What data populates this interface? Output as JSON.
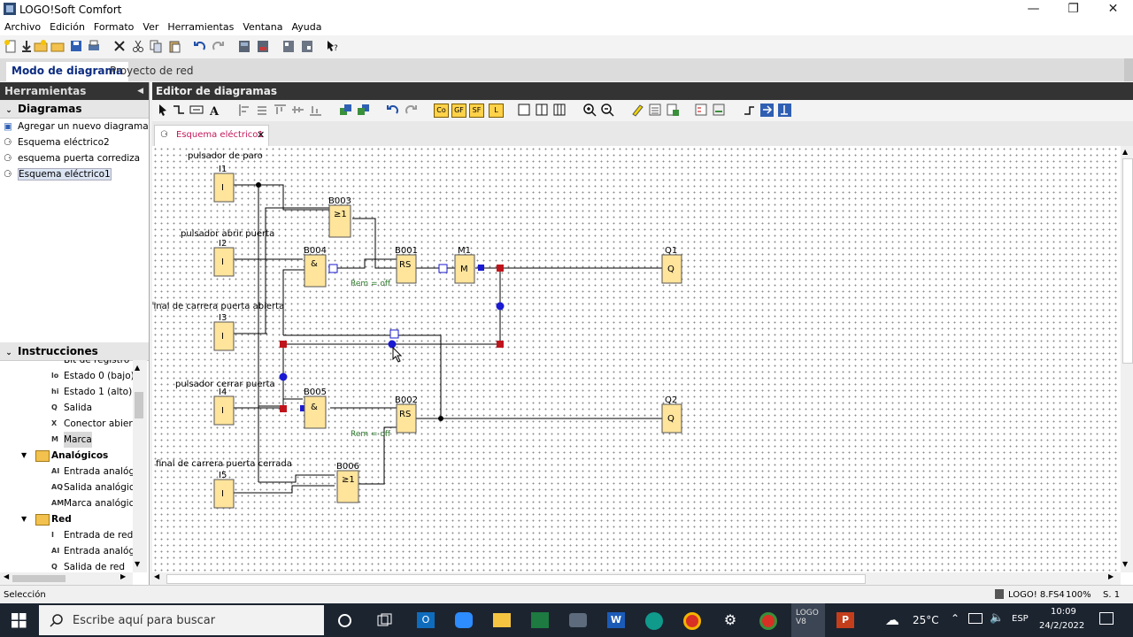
{
  "window": {
    "title": "LOGO!Soft Comfort",
    "minimize": "—",
    "restore": "❐",
    "close": "✕"
  },
  "menu": [
    "Archivo",
    "Edición",
    "Formato",
    "Ver",
    "Herramientas",
    "Ventana",
    "Ayuda"
  ],
  "mode_tabs": {
    "diagram": "Modo de diagrama",
    "network": "Proyecto de red"
  },
  "tools_panel": {
    "title": "Herramientas",
    "diagrams_header": "Diagramas",
    "diagrams": [
      "Agregar un nuevo diagrama",
      "Esquema eléctrico2",
      "esquema puerta corrediza",
      "Esquema eléctrico1"
    ],
    "instructions_header": "Instrucciones",
    "instructions": [
      {
        "icon": "",
        "label": "Bit de registro de",
        "level": 2
      },
      {
        "icon": "lo",
        "label": "Estado 0 (bajo)",
        "level": 2
      },
      {
        "icon": "hi",
        "label": "Estado 1 (alto)",
        "level": 2
      },
      {
        "icon": "Q",
        "label": "Salida",
        "level": 2
      },
      {
        "icon": "X",
        "label": "Conector abierto",
        "level": 2
      },
      {
        "icon": "M",
        "label": "Marca",
        "level": 2
      },
      {
        "icon": "folder",
        "label": "Analógicos",
        "level": 1
      },
      {
        "icon": "AI",
        "label": "Entrada analógic",
        "level": 2
      },
      {
        "icon": "AQ",
        "label": "Salida analógica",
        "level": 2
      },
      {
        "icon": "AM",
        "label": "Marca analógica",
        "level": 2
      },
      {
        "icon": "folder",
        "label": "Red",
        "level": 1
      },
      {
        "icon": "I",
        "label": "Entrada de red",
        "level": 2
      },
      {
        "icon": "AI",
        "label": "Entrada analógic",
        "level": 2
      },
      {
        "icon": "Q",
        "label": "Salida de red",
        "level": 2
      }
    ]
  },
  "editor": {
    "title": "Editor de diagramas",
    "tab": "Esquema eléctrico1",
    "tool_text": {
      "co": "Co",
      "gf": "GF",
      "sf": "SF",
      "l": "L"
    }
  },
  "diagram": {
    "labels": {
      "i1": "pulsador de paro",
      "i2": "pulsador abrir puerta",
      "i3": "final de carrera puerta abierta",
      "i4": "pulsador cerrar puerta",
      "i5": "final de carrera puerta cerrada"
    },
    "blocks": {
      "I1": {
        "name": "I1",
        "sym": "I"
      },
      "I2": {
        "name": "I2",
        "sym": "I"
      },
      "I3": {
        "name": "I3",
        "sym": "I"
      },
      "I4": {
        "name": "I4",
        "sym": "I"
      },
      "I5": {
        "name": "I5",
        "sym": "I"
      },
      "B003": {
        "name": "B003",
        "sym": "≥1"
      },
      "B004": {
        "name": "B004",
        "sym": "&"
      },
      "B005": {
        "name": "B005",
        "sym": "&"
      },
      "B006": {
        "name": "B006",
        "sym": "≥1"
      },
      "B001": {
        "name": "B001",
        "sym": "RS"
      },
      "B002": {
        "name": "B002",
        "sym": "RS"
      },
      "M1": {
        "name": "M1",
        "sym": "M"
      },
      "Q1": {
        "name": "Q1",
        "sym": "Q"
      },
      "Q2": {
        "name": "Q2",
        "sym": "Q"
      }
    },
    "rem1": "Rem = off",
    "rem2": "Rem = off"
  },
  "status": {
    "left": "Selección",
    "device": "LOGO! 8.FS4",
    "zoom": "100%",
    "page": "S. 1"
  },
  "taskbar": {
    "search_placeholder": "Escribe aquí para buscar",
    "weather": "25°C",
    "lang": "ESP",
    "time": "10:09",
    "date": "24/2/2022",
    "logo_app": "LOGO V8"
  },
  "colors": {
    "block_fill": "#ffe49c",
    "header_dark": "#333333",
    "connector_red": "#c0141c",
    "connector_blue": "#1a1ad2",
    "rem_green": "#2c7a2c"
  }
}
